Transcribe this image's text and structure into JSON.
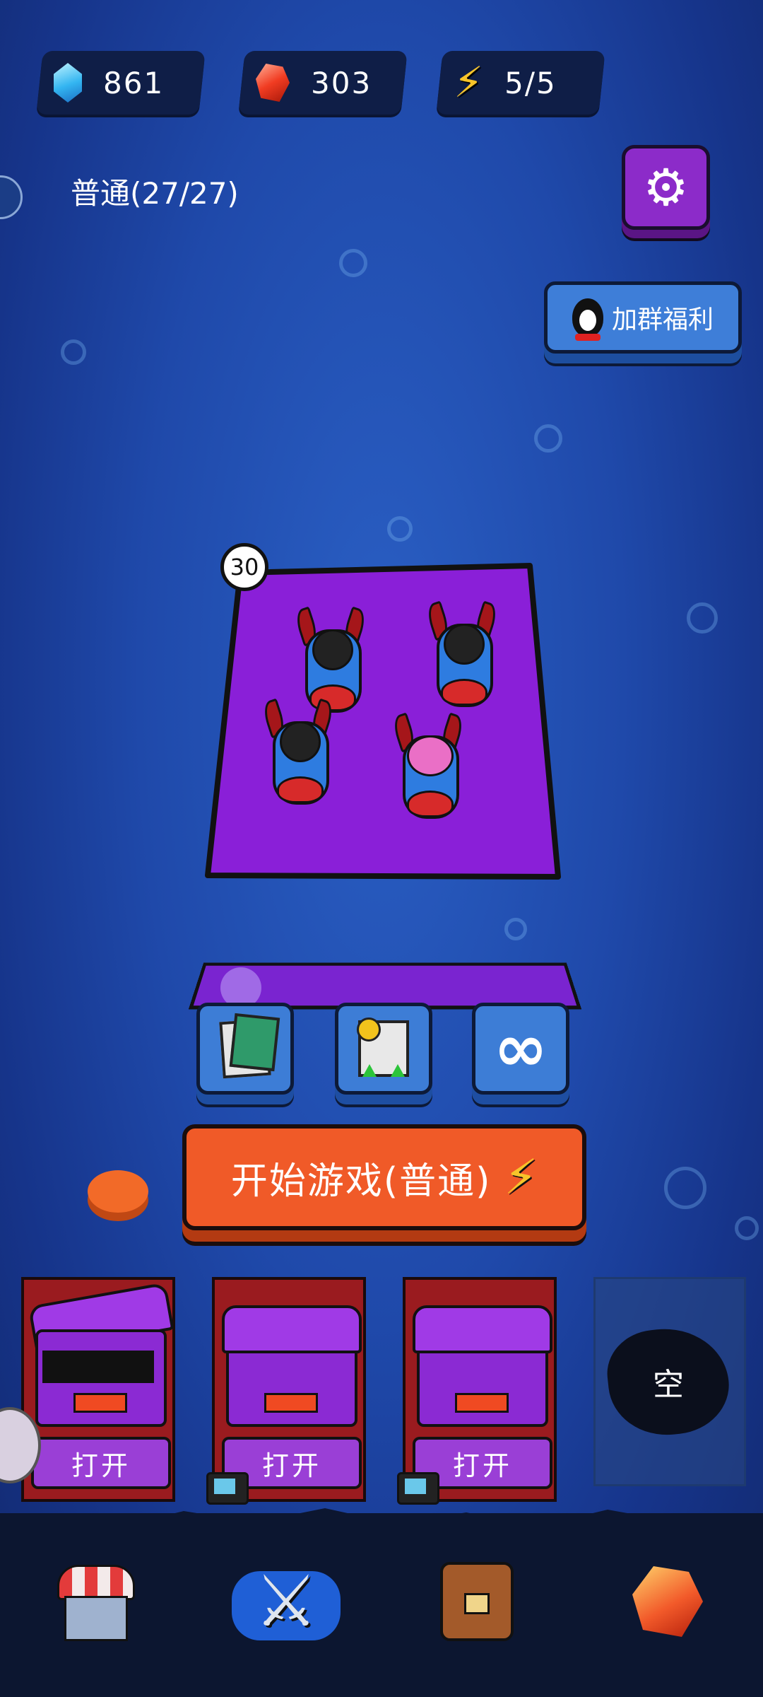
{
  "resources": {
    "gems": "861",
    "rubies": "303",
    "energy": "5/5"
  },
  "mode": {
    "label": "普通(27/27)"
  },
  "buttons": {
    "group_bonus": "加群福利",
    "start_game": "开始游戏(普通)"
  },
  "board": {
    "badge": "30"
  },
  "chests": [
    {
      "action": "打开",
      "state": "open"
    },
    {
      "action": "打开",
      "state": "closed",
      "ad": true
    },
    {
      "action": "打开",
      "state": "closed",
      "ad": true
    }
  ],
  "empty_slot": "空",
  "icons": {
    "gem": "gem-icon",
    "ruby": "ruby-icon",
    "energy": "lightning-icon",
    "settings": "gear-icon",
    "qq": "penguin-icon",
    "abilities": [
      "cards-icon",
      "upgrade-icon",
      "infinity-icon"
    ],
    "nav": [
      "shop-icon",
      "battle-swords-icon",
      "backpack-icon",
      "gem-shop-icon"
    ]
  },
  "colors": {
    "start_button": "#f05a28",
    "board": "#8a1fd8",
    "chest_card": "#9a1b1f"
  },
  "nav": {
    "active": "battle"
  }
}
